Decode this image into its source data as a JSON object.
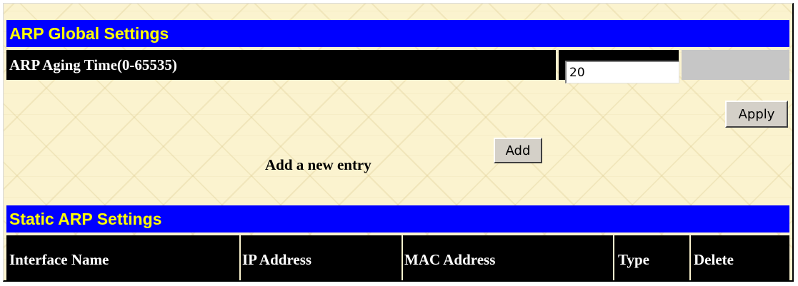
{
  "arp_global": {
    "header": "ARP Global Settings",
    "aging_label": "ARP Aging Time(0-65535)",
    "aging_value": "20",
    "apply_label": "Apply",
    "add_entry_label": "Add a new entry",
    "add_label": "Add"
  },
  "static_arp": {
    "header": "Static ARP Settings",
    "columns": [
      "Interface Name",
      "IP Address",
      "MAC Address",
      "Type",
      "Delete"
    ]
  },
  "colors": {
    "header_bg": "#0000ff",
    "header_text": "#ffff00",
    "row_bg": "#000000",
    "page_bg": "#fbf3cf"
  }
}
